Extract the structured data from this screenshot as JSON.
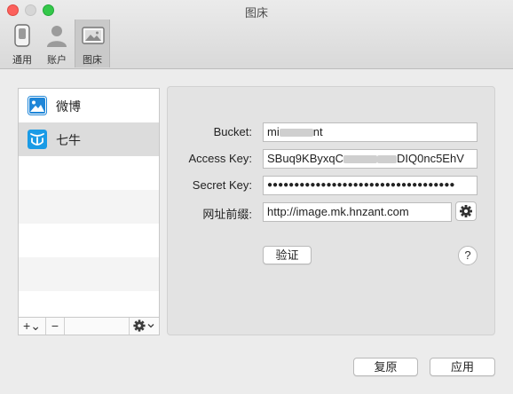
{
  "window": {
    "title": "图床",
    "colors": {
      "close": "#fc605c",
      "minimize": "#d6d6d6",
      "zoom": "#34c84a"
    }
  },
  "toolbar": {
    "items": [
      {
        "label": "通用",
        "icon": "general-switch-icon",
        "selected": false
      },
      {
        "label": "账户",
        "icon": "account-person-icon",
        "selected": false
      },
      {
        "label": "图床",
        "icon": "image-host-icon",
        "selected": true
      }
    ]
  },
  "sidebar": {
    "items": [
      {
        "label": "微博",
        "icon": "weibo-picture-icon",
        "selected": false
      },
      {
        "label": "七牛",
        "icon": "qiniu-icon",
        "selected": true
      }
    ],
    "add_label": "+⌄",
    "remove_label": "−",
    "gear_icon": "gear-dropdown-icon"
  },
  "form": {
    "bucket": {
      "label": "Bucket:",
      "value_prefix": "mi",
      "value_suffix": "nt"
    },
    "access_key": {
      "label": "Access Key:",
      "value_prefix": "SBuq9KByxqC",
      "value_suffix": "DIQ0nc5EhV"
    },
    "secret_key": {
      "label": "Secret Key:",
      "value": "●●●●●●●●●●●●●●●●●●●●●●●●●●●●●●●●●●●"
    },
    "domain": {
      "label": "网址前缀:",
      "value": "http://image.mk.hnzant.com"
    },
    "verify_label": "验证",
    "help_label": "?"
  },
  "footer": {
    "revert_label": "复原",
    "apply_label": "应用"
  }
}
